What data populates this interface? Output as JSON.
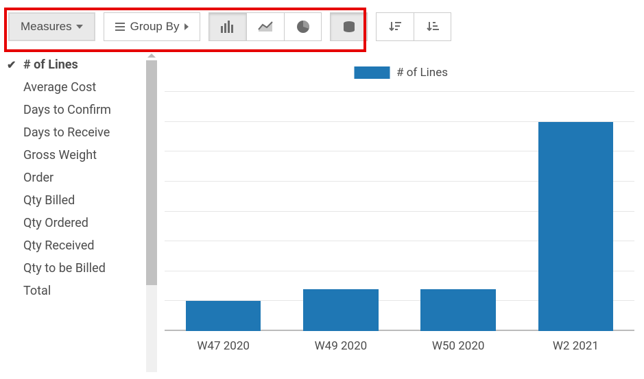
{
  "toolbar": {
    "measures_label": "Measures",
    "groupby_label": "Group By",
    "chart_types": {
      "bar": "bar-chart",
      "line": "line-chart",
      "pie": "pie-chart"
    },
    "active_chart": "bar"
  },
  "measures_dropdown": {
    "items": [
      {
        "label": "# of Lines",
        "checked": true
      },
      {
        "label": "Average Cost",
        "checked": false
      },
      {
        "label": "Days to Confirm",
        "checked": false
      },
      {
        "label": "Days to Receive",
        "checked": false
      },
      {
        "label": "Gross Weight",
        "checked": false
      },
      {
        "label": "Order",
        "checked": false
      },
      {
        "label": "Qty Billed",
        "checked": false
      },
      {
        "label": "Qty Ordered",
        "checked": false
      },
      {
        "label": "Qty Received",
        "checked": false
      },
      {
        "label": "Qty to be Billed",
        "checked": false
      },
      {
        "label": "Total",
        "checked": false
      }
    ]
  },
  "chart_data": {
    "type": "bar",
    "title": "",
    "legend": "# of Lines",
    "xlabel": "",
    "ylabel": "",
    "categories": [
      "W47 2020",
      "W49 2020",
      "W50 2020",
      "W2 2021"
    ],
    "values": [
      1,
      1.4,
      1.4,
      7
    ],
    "ylim": [
      0,
      8
    ],
    "grid": true,
    "colors": {
      "series": "#1f77b4"
    }
  }
}
